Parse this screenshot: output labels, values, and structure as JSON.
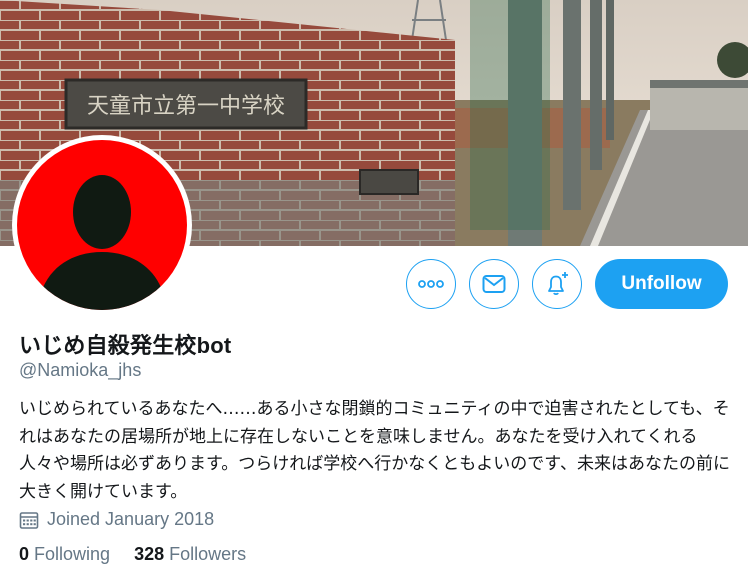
{
  "banner": {
    "plaque_text": "天童市立第一中学校",
    "photo_description_icon": "school-gate-photo"
  },
  "avatar": {
    "icon": "default-avatar-silhouette",
    "background_color": "#ff0000",
    "silhouette_color": "#101a12"
  },
  "actions": {
    "more_icon": "more-icon",
    "message_icon": "envelope-icon",
    "notify_icon": "bell-plus-icon",
    "unfollow_label": "Unfollow",
    "accent_color": "#1da1f2"
  },
  "profile": {
    "name": "いじめ自殺発生校bot",
    "handle": "@Namioka_jhs",
    "bio": "いじめられているあなたへ……ある小さな閉鎖的コミュニティの中で迫害されたとしても、それはあなたの居場所が地上に存在しないことを意味しません。あなたを受け入れてくれる人々や場所は必ずあります。つらければ学校へ行かなくともよいのです、未来はあなたの前に大きく開けています。",
    "joined_icon": "calendar-icon",
    "joined": "Joined January 2018"
  },
  "stats": {
    "following_count": "0",
    "following_label": "Following",
    "followers_count": "328",
    "followers_label": "Followers"
  }
}
